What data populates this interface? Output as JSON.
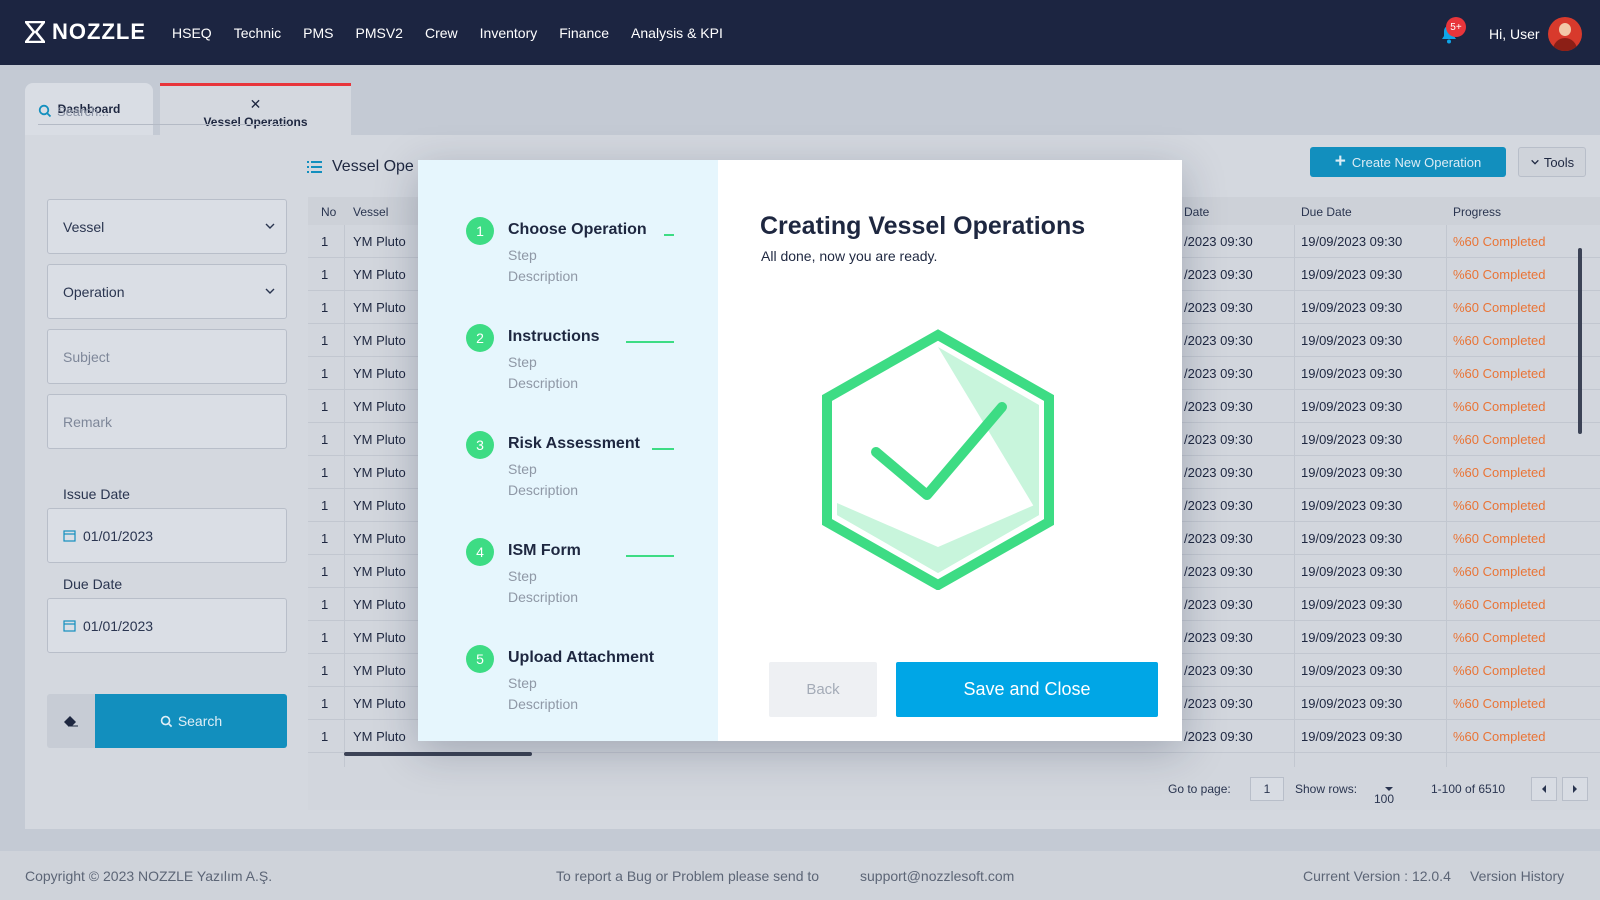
{
  "brand": {
    "name": "NOZZLE"
  },
  "nav": {
    "items": [
      "HSEQ",
      "Technic",
      "PMS",
      "PMSV2",
      "Crew",
      "Inventory",
      "Finance",
      "Analysis & KPI"
    ],
    "notification_badge": "5+",
    "greeting": "Hi, User"
  },
  "tabs": {
    "dashboard": "Dashboard",
    "vessel_operations": "Vessel Operations"
  },
  "filters": {
    "search_placeholder": "Search...",
    "vessel": "Vessel",
    "operation": "Operation",
    "subject_placeholder": "Subject",
    "remark_placeholder": "Remark",
    "issue_date_label": "Issue Date",
    "issue_date": "01/01/2023",
    "due_date_label": "Due Date",
    "due_date": "01/01/2023",
    "search_button": "Search"
  },
  "list": {
    "title": "Vessel Ope",
    "create_button": "Create New Operation",
    "tools_button": "Tools",
    "columns": {
      "no": "No",
      "vessel": "Vessel",
      "date": "Date",
      "due_date": "Due Date",
      "progress": "Progress"
    },
    "rows": [
      {
        "no": "1",
        "vessel": "YM Pluto",
        "date": "/2023 09:30",
        "due": "19/09/2023 09:30",
        "progress": "%60 Completed"
      },
      {
        "no": "1",
        "vessel": "YM Pluto",
        "date": "/2023 09:30",
        "due": "19/09/2023 09:30",
        "progress": "%60 Completed"
      },
      {
        "no": "1",
        "vessel": "YM Pluto",
        "date": "/2023 09:30",
        "due": "19/09/2023 09:30",
        "progress": "%60 Completed"
      },
      {
        "no": "1",
        "vessel": "YM Pluto",
        "date": "/2023 09:30",
        "due": "19/09/2023 09:30",
        "progress": "%60 Completed"
      },
      {
        "no": "1",
        "vessel": "YM Pluto",
        "date": "/2023 09:30",
        "due": "19/09/2023 09:30",
        "progress": "%60 Completed"
      },
      {
        "no": "1",
        "vessel": "YM Pluto",
        "date": "/2023 09:30",
        "due": "19/09/2023 09:30",
        "progress": "%60 Completed"
      },
      {
        "no": "1",
        "vessel": "YM Pluto",
        "date": "/2023 09:30",
        "due": "19/09/2023 09:30",
        "progress": "%60 Completed"
      },
      {
        "no": "1",
        "vessel": "YM Pluto",
        "date": "/2023 09:30",
        "due": "19/09/2023 09:30",
        "progress": "%60 Completed"
      },
      {
        "no": "1",
        "vessel": "YM Pluto",
        "date": "/2023 09:30",
        "due": "19/09/2023 09:30",
        "progress": "%60 Completed"
      },
      {
        "no": "1",
        "vessel": "YM Pluto",
        "date": "/2023 09:30",
        "due": "19/09/2023 09:30",
        "progress": "%60 Completed"
      },
      {
        "no": "1",
        "vessel": "YM Pluto",
        "date": "/2023 09:30",
        "due": "19/09/2023 09:30",
        "progress": "%60 Completed"
      },
      {
        "no": "1",
        "vessel": "YM Pluto",
        "date": "/2023 09:30",
        "due": "19/09/2023 09:30",
        "progress": "%60 Completed"
      },
      {
        "no": "1",
        "vessel": "YM Pluto",
        "date": "/2023 09:30",
        "due": "19/09/2023 09:30",
        "progress": "%60 Completed"
      },
      {
        "no": "1",
        "vessel": "YM Pluto",
        "date": "/2023 09:30",
        "due": "19/09/2023 09:30",
        "progress": "%60 Completed"
      },
      {
        "no": "1",
        "vessel": "YM Pluto",
        "date": "/2023 09:30",
        "due": "19/09/2023 09:30",
        "progress": "%60 Completed"
      },
      {
        "no": "1",
        "vessel": "YM Pluto",
        "date": "/2023 09:30",
        "due": "19/09/2023 09:30",
        "progress": "%60 Completed"
      }
    ],
    "pager": {
      "go_to_page_label": "Go to page:",
      "page": "1",
      "show_rows_label": "Show rows:",
      "rows_per_page": "100",
      "range": "1-100 of 6510"
    }
  },
  "modal": {
    "title": "Creating Vessel Operations",
    "subtitle": "All done, now you are ready.",
    "steps": [
      {
        "num": "1",
        "title": "Choose Operation",
        "sub1": "Step",
        "sub2": "Description"
      },
      {
        "num": "2",
        "title": "Instructions",
        "sub1": "Step",
        "sub2": "Description"
      },
      {
        "num": "3",
        "title": "Risk Assessment",
        "sub1": "Step",
        "sub2": "Description"
      },
      {
        "num": "4",
        "title": "ISM Form",
        "sub1": "Step",
        "sub2": "Description"
      },
      {
        "num": "5",
        "title": "Upload Attachment",
        "sub1": "Step",
        "sub2": "Description"
      }
    ],
    "back_button": "Back",
    "save_button": "Save and Close"
  },
  "footer": {
    "copyright": "Copyright © 2023   NOZZLE Yazılım A.Ş.",
    "report_text": "To report a Bug or Problem please send to",
    "email": "support@nozzlesoft.com",
    "version": "Current Version : 12.0.4",
    "version_history": "Version History"
  },
  "colors": {
    "nav_bg": "#1c2541",
    "accent_blue": "#00a6e6",
    "success_green": "#3ddc84",
    "progress_orange": "#e97436",
    "alert_red": "#e8353b"
  },
  "icons": [
    "logo-icon",
    "bell-icon",
    "search-icon",
    "chevron-down-icon",
    "calendar-icon",
    "eraser-icon",
    "list-icon",
    "plus-icon",
    "close-icon",
    "check-hexagon-icon",
    "arrow-left-icon",
    "arrow-right-icon"
  ]
}
